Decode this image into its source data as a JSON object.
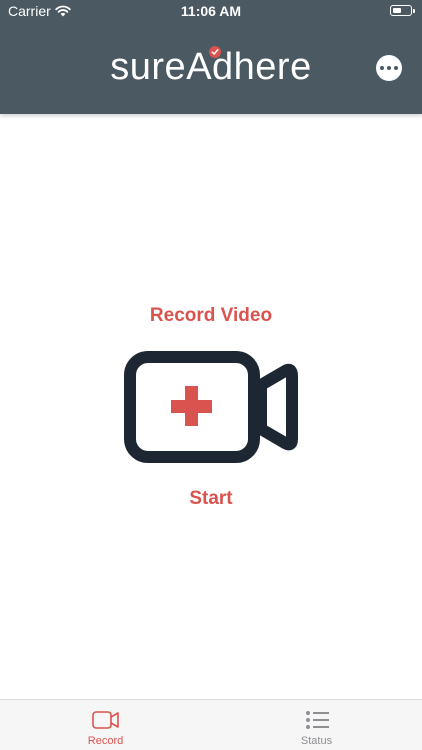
{
  "status_bar": {
    "carrier": "Carrier",
    "time": "11:06 AM",
    "wifi_icon": "wifi-icon",
    "battery_icon": "battery-icon"
  },
  "header": {
    "app_name": "sureAdhere",
    "logo_badge_icon": "checkmark-badge-icon",
    "more_icon": "more-options-icon",
    "background_color": "#4b5963"
  },
  "main": {
    "title": "Record Video",
    "camera_icon": "video-camera-plus-icon",
    "start_label": "Start",
    "accent_color": "#d9534f",
    "icon_color": "#1d2733"
  },
  "tabs": [
    {
      "label": "Record",
      "icon": "video-camera-icon",
      "active": true
    },
    {
      "label": "Status",
      "icon": "list-icon",
      "active": false
    }
  ]
}
